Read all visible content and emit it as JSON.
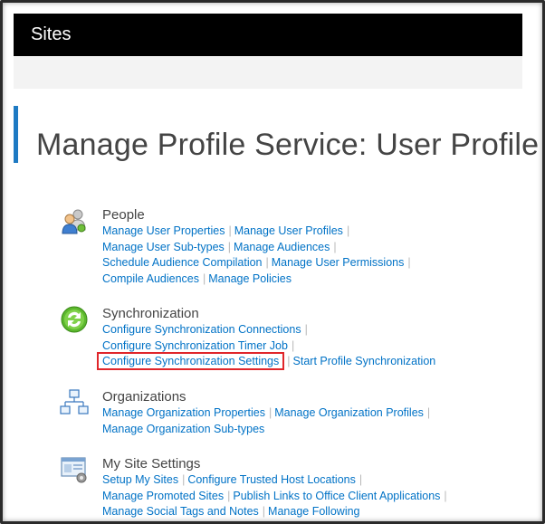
{
  "header": {
    "title": "Sites"
  },
  "page": {
    "title": "Manage Profile Service: User Profile"
  },
  "sections": [
    {
      "heading": "People",
      "icon": "people-icon",
      "lines": [
        [
          "Manage User Properties",
          "Manage User Profiles"
        ],
        [
          "Manage User Sub-types",
          "Manage Audiences"
        ],
        [
          "Schedule Audience Compilation",
          "Manage User Permissions"
        ],
        [
          "Compile Audiences",
          "Manage Policies"
        ]
      ]
    },
    {
      "heading": "Synchronization",
      "icon": "sync-icon",
      "lines": [
        [
          "Configure Synchronization Connections"
        ],
        [
          "Configure Synchronization Timer Job"
        ],
        [
          "Configure Synchronization Settings",
          "Start Profile Synchronization"
        ]
      ],
      "highlighted_link": "Configure Synchronization Settings"
    },
    {
      "heading": "Organizations",
      "icon": "org-chart-icon",
      "lines": [
        [
          "Manage Organization Properties",
          "Manage Organization Profiles"
        ],
        [
          "Manage Organization Sub-types"
        ]
      ]
    },
    {
      "heading": "My Site Settings",
      "icon": "my-site-icon",
      "lines": [
        [
          "Setup My Sites",
          "Configure Trusted Host Locations"
        ],
        [
          "Manage Promoted Sites",
          "Publish Links to Office Client Applications"
        ],
        [
          "Manage Social Tags and Notes",
          "Manage Following"
        ]
      ]
    }
  ],
  "separator": "|",
  "colors": {
    "link": "#0072c6",
    "accent": "#1e7ac3",
    "highlight": "#e0262b"
  }
}
